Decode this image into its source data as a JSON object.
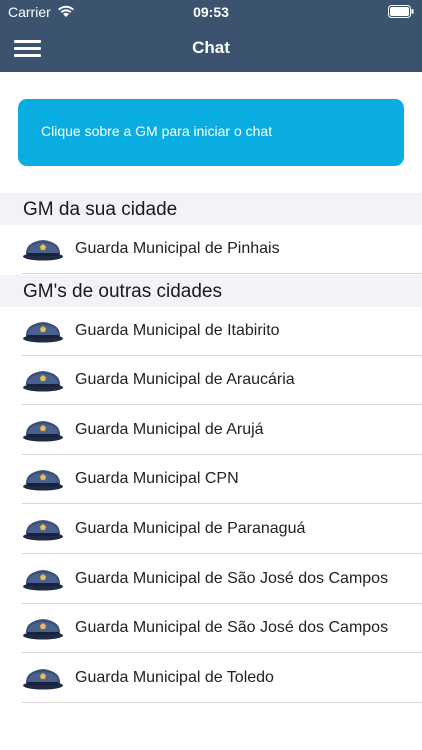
{
  "status_bar": {
    "carrier": "Carrier",
    "time": "09:53"
  },
  "nav": {
    "title": "Chat",
    "menu_icon": "hamburger-menu-icon"
  },
  "banner": {
    "text": "Clique sobre a GM para iniciar o chat",
    "color": "#09ade2"
  },
  "sections": [
    {
      "title": "GM da sua cidade",
      "items": [
        "Guarda Municipal de Pinhais"
      ]
    },
    {
      "title": "GM's de outras cidades",
      "items": [
        "Guarda Municipal de Itabirito",
        "Guarda Municipal de Araucária",
        "Guarda Municipal de Arujá",
        "Guarda Municipal CPN",
        "Guarda Municipal de Paranaguá",
        "Guarda Municipal de São José dos Campos",
        "Guarda Municipal de São José dos Campos",
        "Guarda Municipal de Toledo"
      ]
    }
  ],
  "item_icon": "police-cap-icon",
  "colors": {
    "nav_bar": "#3b536f",
    "section_header_bg": "#f2f2f7"
  }
}
